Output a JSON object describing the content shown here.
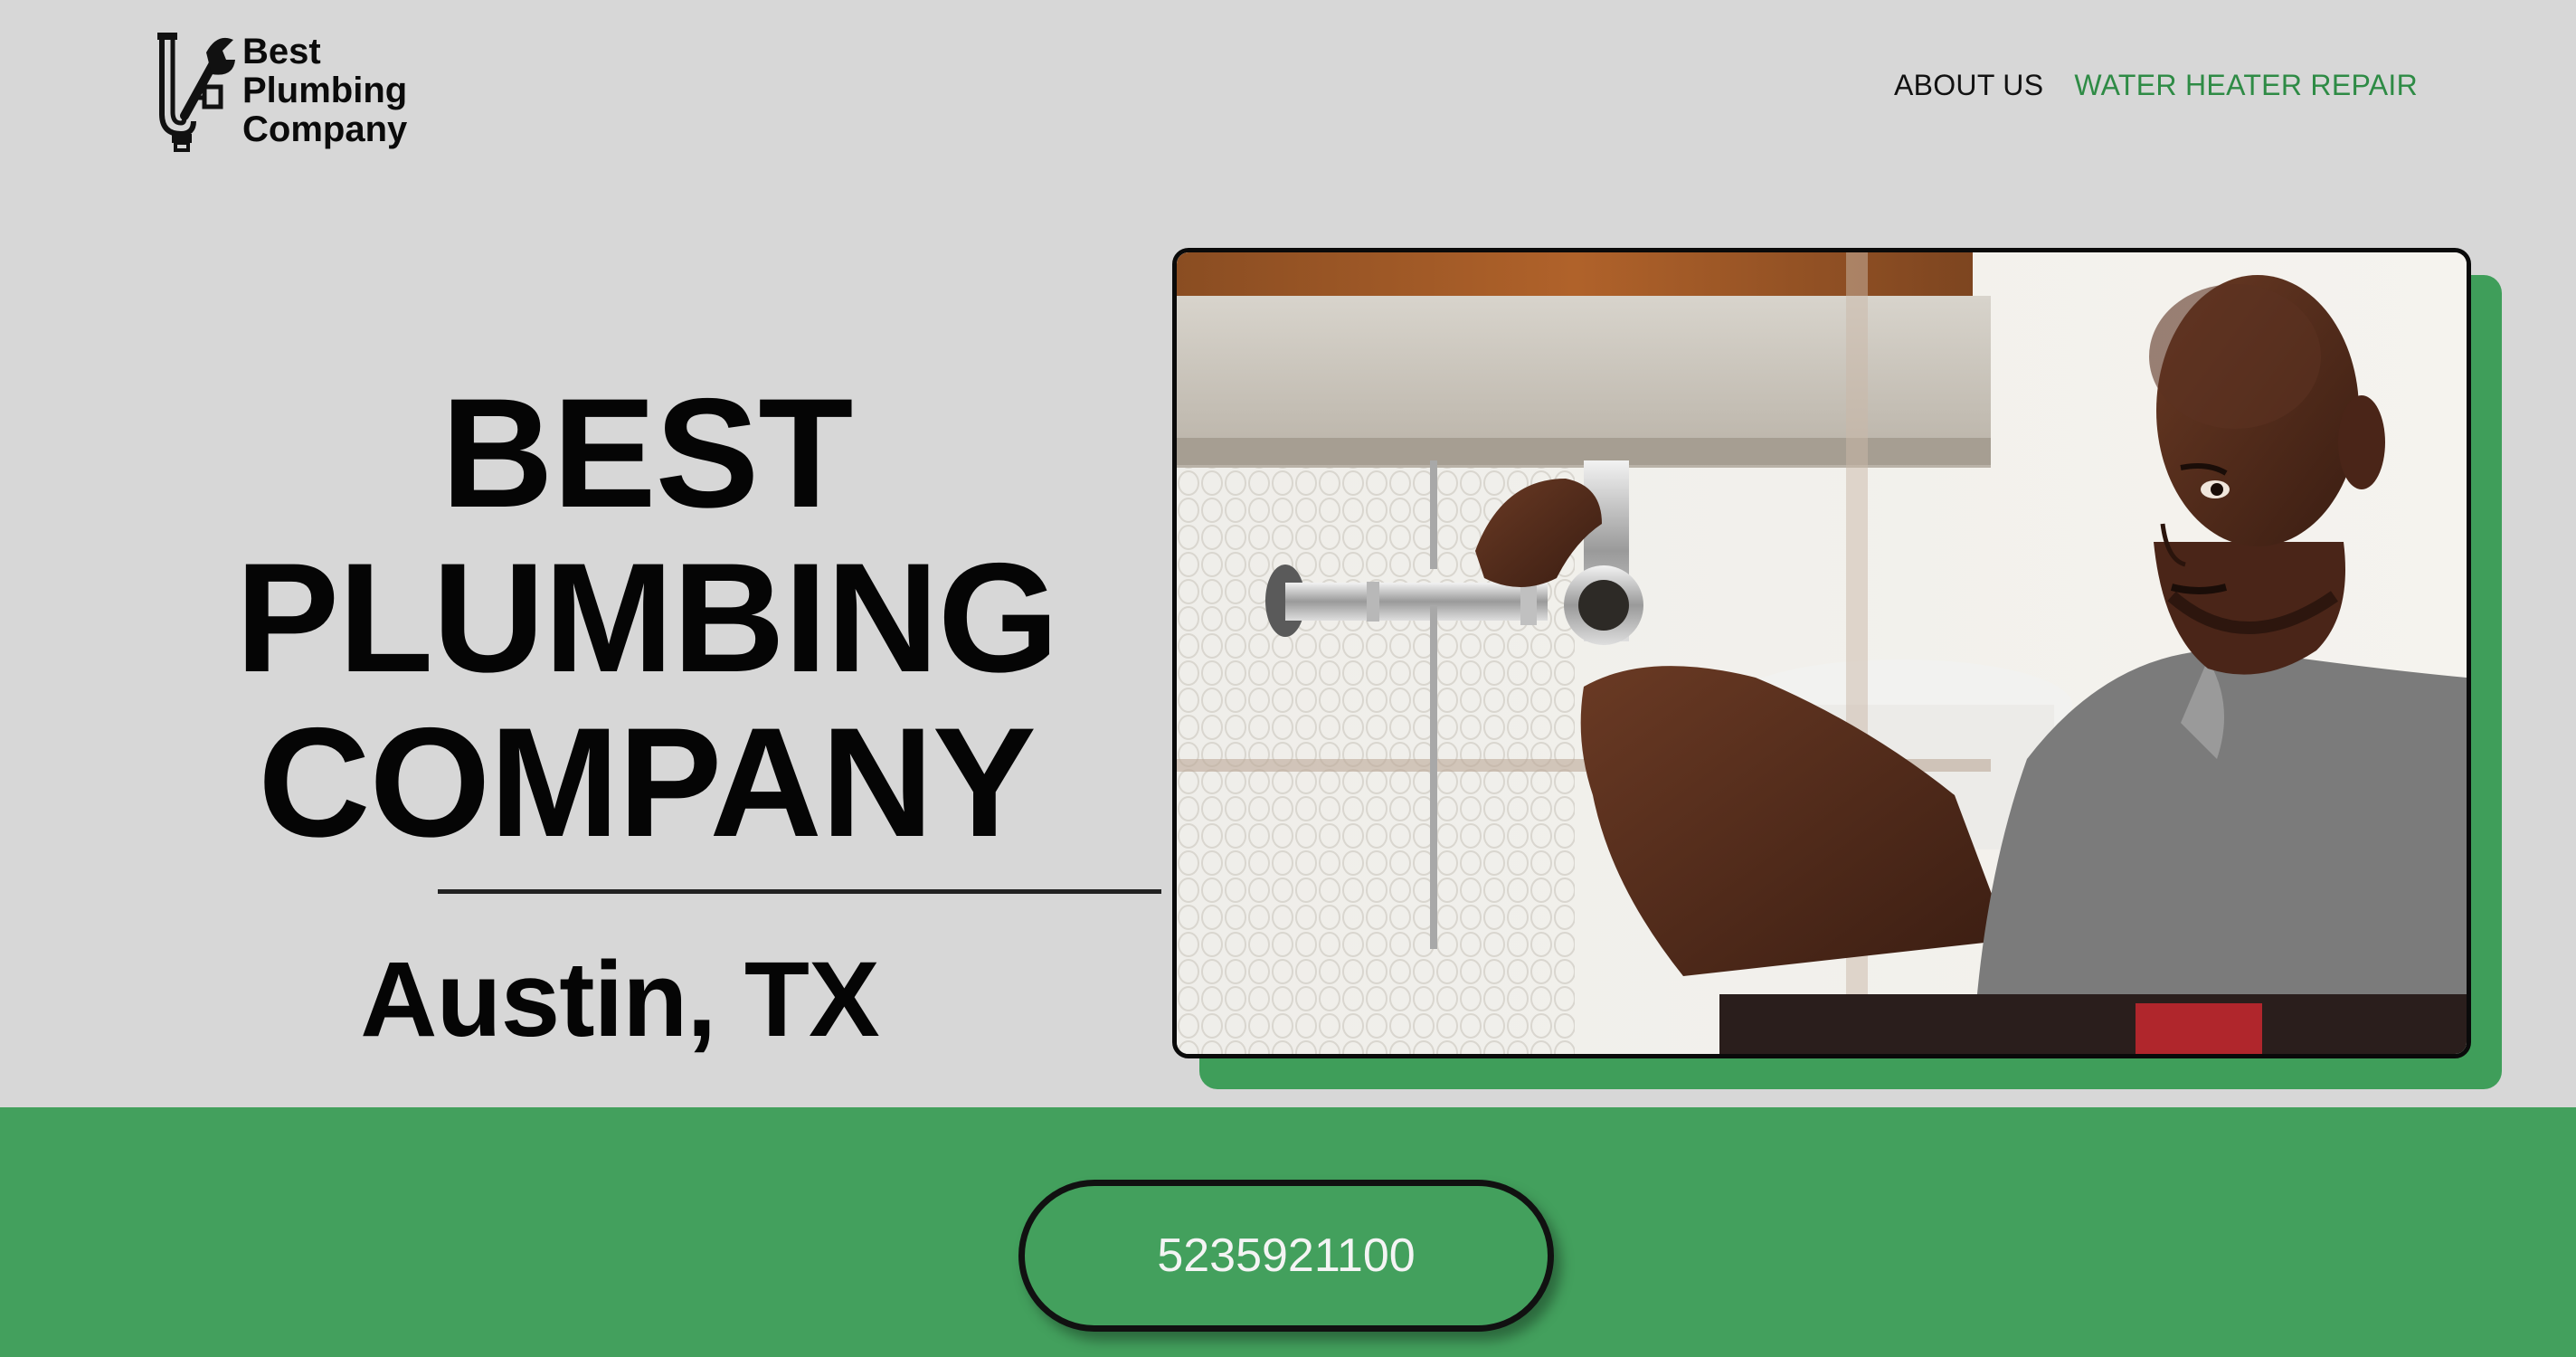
{
  "header": {
    "logo_lines": [
      "Best",
      "Plumbing",
      "Company"
    ],
    "nav": [
      {
        "label": "ABOUT US",
        "color": "#111111"
      },
      {
        "label": "WATER HEATER REPAIR",
        "color": "#2e8b45"
      }
    ]
  },
  "hero": {
    "title_lines": [
      "BEST",
      "PLUMBING",
      "COMPANY"
    ],
    "city": "Austin, TX",
    "image_alt": "plumber-fixing-sink-pipe-photo"
  },
  "cta": {
    "phone": "5235921100"
  },
  "colors": {
    "background": "#d7d7d7",
    "accent_green": "#43a05d",
    "nav_green": "#2e8b45",
    "text": "#050505"
  }
}
